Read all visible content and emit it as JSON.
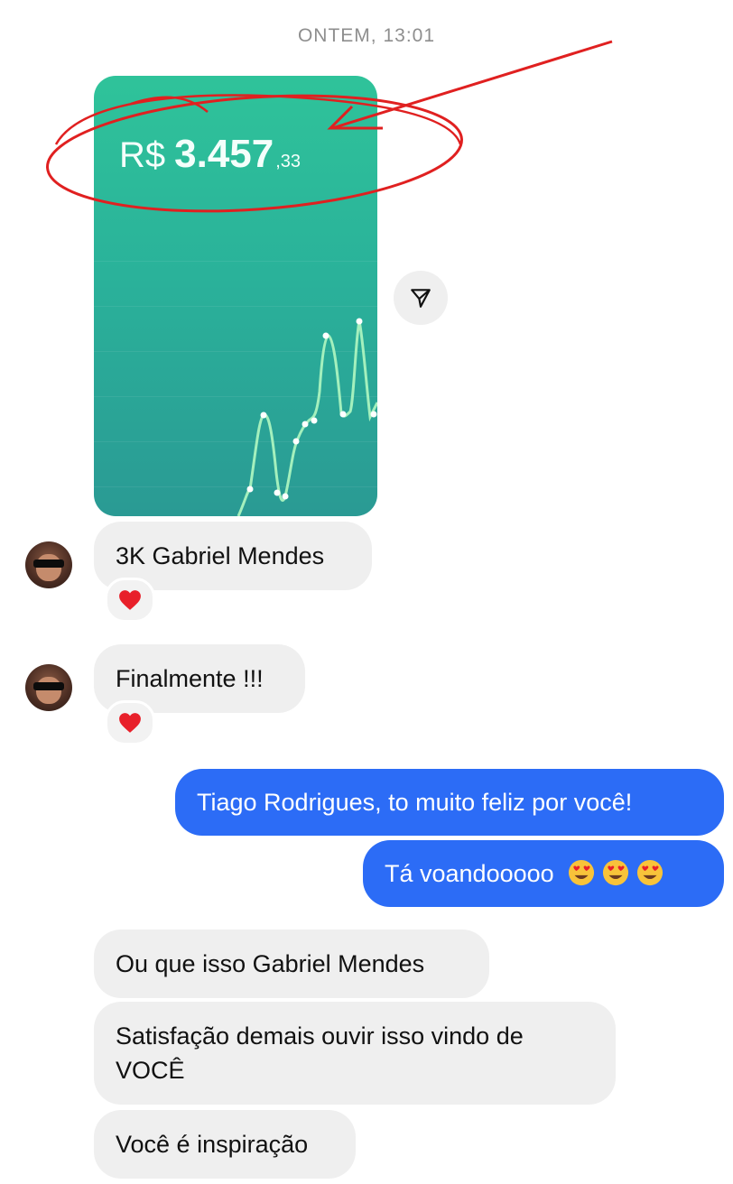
{
  "timestamp": "ONTEM, 13:01",
  "story": {
    "currency": "R$",
    "amount_integer": "3.457",
    "amount_cents": ",33",
    "chart_line_color": "#9ff0b8",
    "card_color": "#2bb89a"
  },
  "icons": {
    "share": "paper-plane-icon",
    "reaction": "heart-icon",
    "emoji": "heart-eyes-emoji"
  },
  "annotation": {
    "color": "#e02020"
  },
  "messages": [
    {
      "side": "in",
      "text": "3K Gabriel Mendes",
      "reaction": "❤️"
    },
    {
      "side": "in",
      "text": "Finalmente !!!",
      "reaction": "❤️"
    },
    {
      "side": "out",
      "text": "Tiago Rodrigues, to muito feliz por você!"
    },
    {
      "side": "out",
      "text": "Tá voandooooo"
    },
    {
      "side": "in",
      "text": "Ou que isso Gabriel Mendes"
    },
    {
      "side": "in",
      "text": "Satisfação demais ouvir isso vindo de VOCÊ"
    },
    {
      "side": "in",
      "text": "Você é inspiração"
    }
  ]
}
